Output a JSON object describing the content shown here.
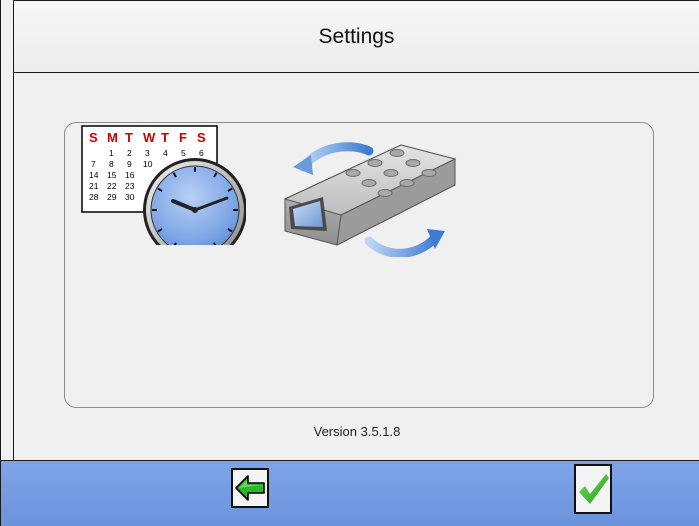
{
  "header": {
    "title": "Settings"
  },
  "calendar": {
    "day_headers": [
      "S",
      "M",
      "T",
      "W",
      "T",
      "F",
      "S"
    ],
    "rows": [
      [
        "",
        "1",
        "2",
        "3",
        "4",
        "5",
        "6"
      ],
      [
        "7",
        "8",
        "9",
        "10",
        "",
        "",
        ""
      ],
      [
        "14",
        "15",
        "16",
        "",
        "",
        "",
        ""
      ],
      [
        "21",
        "22",
        "23",
        "",
        "",
        "",
        ""
      ],
      [
        "28",
        "29",
        "30",
        "",
        "",
        "",
        ""
      ]
    ]
  },
  "panel": {
    "icons": [
      "date-time-icon",
      "device-sync-icon"
    ]
  },
  "footer": {
    "version": "Version 3.5.1.8",
    "back_icon": "green-left-arrow-icon",
    "ok_icon": "green-checkmark-icon"
  },
  "colors": {
    "footer_bg": "#7aa0e6",
    "calendar_header": "#cc0000",
    "arrow_green": "#2db52d",
    "clock_face": "#7ea6e6"
  }
}
